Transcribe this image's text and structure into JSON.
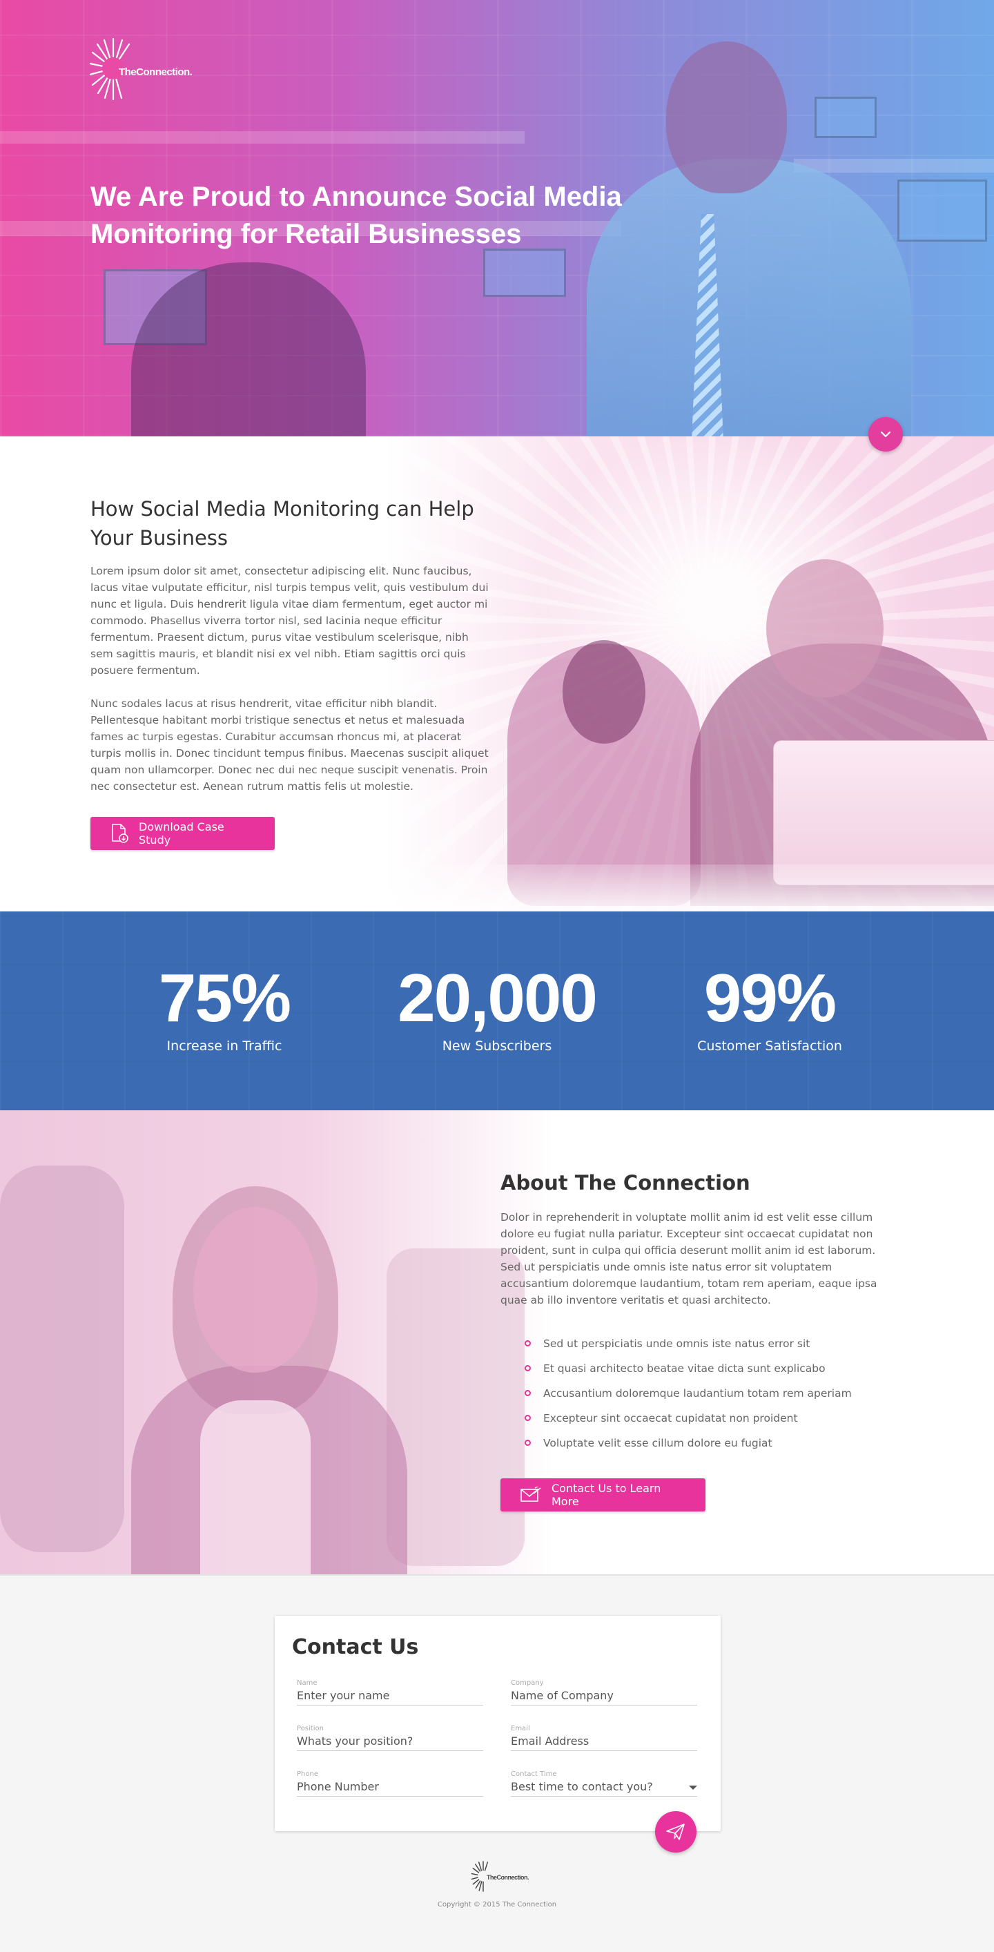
{
  "brand": {
    "name": "TheConnection.",
    "footer_name": "TheConnection."
  },
  "hero": {
    "title": "We Are Proud to Announce Social Media Monitoring for Retail Businesses"
  },
  "help_section": {
    "title": "How Social Media Monitoring can Help Your Business",
    "paragraph_1": "Lorem ipsum dolor sit amet, consectetur adipiscing elit. Nunc faucibus, lacus vitae vulputate efficitur, nisl turpis tempus velit, quis vestibulum dui nunc et ligula. Duis hendrerit ligula vitae diam fermentum, eget auctor mi commodo. Phasellus viverra tortor nisl, sed lacinia neque efficitur fermentum. Praesent dictum, purus vitae vestibulum scelerisque, nibh sem sagittis mauris, et blandit nisi ex vel nibh. Etiam sagittis orci quis posuere fermentum.",
    "paragraph_2": "Nunc sodales lacus at risus hendrerit, vitae efficitur nibh blandit. Pellentesque habitant morbi tristique senectus et netus et malesuada fames ac turpis egestas. Curabitur accumsan rhoncus mi, at placerat turpis mollis in. Donec tincidunt tempus finibus. Maecenas suscipit aliquet quam non ullamcorper. Donec nec dui nec neque suscipit venenatis. Proin nec consectetur est. Aenean rutrum mattis felis ut molestie.",
    "button_label": "Download Case Study"
  },
  "stats": [
    {
      "value": "75%",
      "label": "Increase in Traffic"
    },
    {
      "value": "20,000",
      "label": "New Subscribers"
    },
    {
      "value": "99%",
      "label": "Customer Satisfaction"
    }
  ],
  "about": {
    "title": "About The Connection",
    "paragraph": "Dolor in reprehenderit in voluptate mollit anim id est  velit esse cillum dolore eu fugiat nulla pariatur. Excepteur sint occaecat cupidatat non proident, sunt in culpa qui officia deserunt mollit anim id est laborum. Sed ut perspiciatis unde omnis iste natus error sit voluptatem accusantium doloremque laudantium, totam rem aperiam, eaque ipsa quae ab illo inventore veritatis et quasi architecto.",
    "bullets": [
      "Sed ut perspiciatis unde omnis iste natus error sit",
      "Et quasi architecto beatae vitae dicta sunt explicabo",
      "Accusantium doloremque laudantium totam rem aperiam",
      "Excepteur sint occaecat cupidatat non proident",
      "Voluptate velit esse cillum dolore eu fugiat"
    ],
    "button_label": "Contact Us to Learn More"
  },
  "contact": {
    "title": "Contact Us",
    "fields": {
      "name": {
        "label": "Name",
        "placeholder": "Enter your name"
      },
      "company": {
        "label": "Company",
        "placeholder": "Name of Company"
      },
      "position": {
        "label": "Position",
        "placeholder": "Whats your position?"
      },
      "email": {
        "label": "Email",
        "placeholder": "Email Address"
      },
      "phone": {
        "label": "Phone",
        "placeholder": "Phone Number"
      },
      "contact_time": {
        "label": "Contact Time",
        "placeholder": "Best time to contact you?"
      }
    }
  },
  "footer": {
    "copyright": "Copyright © 2015 The Connection"
  },
  "colors": {
    "accent": "#e8339c",
    "stats_bg": "#3b6cb3",
    "hero_left": "#e94aa4",
    "hero_right": "#6fa8e8"
  },
  "icons": {
    "logo": "sunburst-logo-icon",
    "down": "chevron-down-icon",
    "download": "document-download-icon",
    "mail": "envelope-icon",
    "send": "paper-plane-icon",
    "select": "caret-down-icon"
  }
}
